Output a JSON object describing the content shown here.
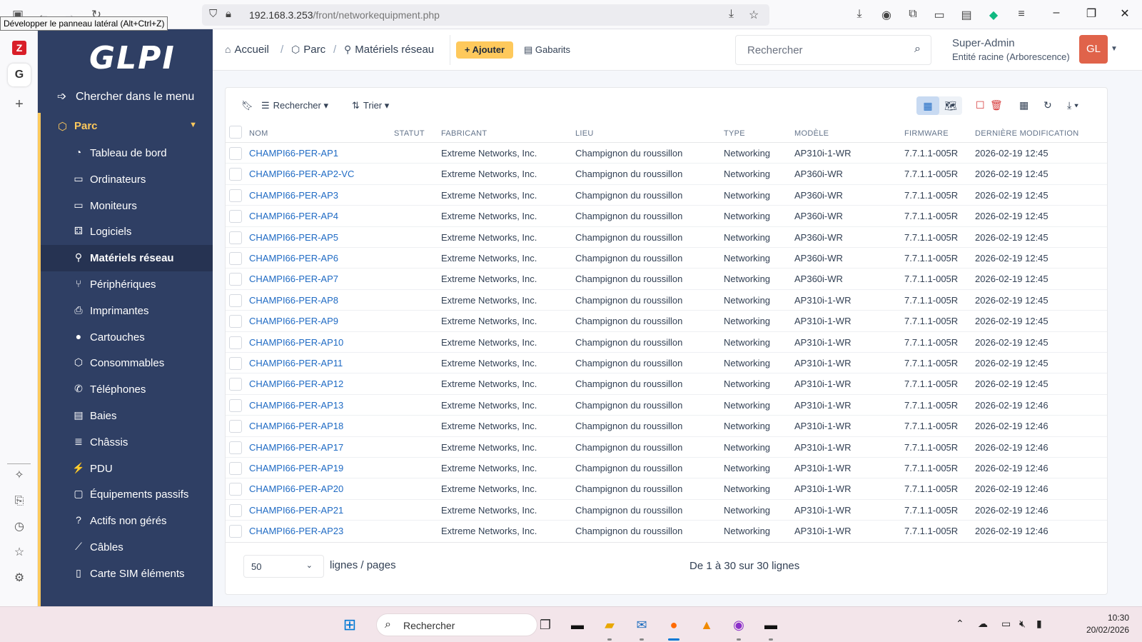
{
  "browser": {
    "tooltip": "Développer le panneau latéral (Alt+Ctrl+Z)",
    "url_host": "192.168.3.253",
    "url_path": "/front/networkequipment.php"
  },
  "sidebar": {
    "logo": "GLPI",
    "search_label": "Chercher dans le menu",
    "section": "Parc",
    "items": [
      {
        "label": "Tableau de bord",
        "icon": "dashboard-icon"
      },
      {
        "label": "Ordinateurs",
        "icon": "laptop-icon"
      },
      {
        "label": "Moniteurs",
        "icon": "monitor-icon"
      },
      {
        "label": "Logiciels",
        "icon": "apps-icon"
      },
      {
        "label": "Matériels réseau",
        "icon": "network-icon"
      },
      {
        "label": "Périphériques",
        "icon": "usb-icon"
      },
      {
        "label": "Imprimantes",
        "icon": "printer-icon"
      },
      {
        "label": "Cartouches",
        "icon": "droplet-icon"
      },
      {
        "label": "Consommables",
        "icon": "package-icon"
      },
      {
        "label": "Téléphones",
        "icon": "phone-icon"
      },
      {
        "label": "Baies",
        "icon": "server-icon"
      },
      {
        "label": "Châssis",
        "icon": "list-icon"
      },
      {
        "label": "PDU",
        "icon": "plug-icon"
      },
      {
        "label": "Équipements passifs",
        "icon": "box-icon"
      },
      {
        "label": "Actifs non gérés",
        "icon": "question-icon"
      },
      {
        "label": "Câbles",
        "icon": "cable-icon"
      },
      {
        "label": "Carte SIM éléments",
        "icon": "sim-icon"
      }
    ],
    "active_index": 4
  },
  "header": {
    "breadcrumbs": [
      "Accueil",
      "Parc",
      "Matériels réseau"
    ],
    "add_label": "Ajouter",
    "templates_label": "Gabarits",
    "search_placeholder": "Rechercher",
    "user_name": "Super-Admin",
    "user_entity": "Entité racine (Arborescence)",
    "avatar_initials": "GL"
  },
  "toolbar": {
    "search_label": "Rechercher",
    "sort_label": "Trier"
  },
  "table": {
    "columns": [
      "NOM",
      "STATUT",
      "FABRICANT",
      "LIEU",
      "TYPE",
      "MODÈLE",
      "FIRMWARE",
      "DERNIÈRE MODIFICATION"
    ],
    "rows": [
      {
        "nom": "CHAMPI66-PER-AP1",
        "statut": "",
        "fabricant": "Extreme Networks, Inc.",
        "lieu": "Champignon du roussillon",
        "type": "Networking",
        "modele": "AP310i-1-WR",
        "firmware": "7.7.1.1-005R",
        "modif": "2026-02-19 12:45"
      },
      {
        "nom": "CHAMPI66-PER-AP2-VC",
        "statut": "",
        "fabricant": "Extreme Networks, Inc.",
        "lieu": "Champignon du roussillon",
        "type": "Networking",
        "modele": "AP360i-WR",
        "firmware": "7.7.1.1-005R",
        "modif": "2026-02-19 12:45"
      },
      {
        "nom": "CHAMPI66-PER-AP3",
        "statut": "",
        "fabricant": "Extreme Networks, Inc.",
        "lieu": "Champignon du roussillon",
        "type": "Networking",
        "modele": "AP360i-WR",
        "firmware": "7.7.1.1-005R",
        "modif": "2026-02-19 12:45"
      },
      {
        "nom": "CHAMPI66-PER-AP4",
        "statut": "",
        "fabricant": "Extreme Networks, Inc.",
        "lieu": "Champignon du roussillon",
        "type": "Networking",
        "modele": "AP360i-WR",
        "firmware": "7.7.1.1-005R",
        "modif": "2026-02-19 12:45"
      },
      {
        "nom": "CHAMPI66-PER-AP5",
        "statut": "",
        "fabricant": "Extreme Networks, Inc.",
        "lieu": "Champignon du roussillon",
        "type": "Networking",
        "modele": "AP360i-WR",
        "firmware": "7.7.1.1-005R",
        "modif": "2026-02-19 12:45"
      },
      {
        "nom": "CHAMPI66-PER-AP6",
        "statut": "",
        "fabricant": "Extreme Networks, Inc.",
        "lieu": "Champignon du roussillon",
        "type": "Networking",
        "modele": "AP360i-WR",
        "firmware": "7.7.1.1-005R",
        "modif": "2026-02-19 12:45"
      },
      {
        "nom": "CHAMPI66-PER-AP7",
        "statut": "",
        "fabricant": "Extreme Networks, Inc.",
        "lieu": "Champignon du roussillon",
        "type": "Networking",
        "modele": "AP360i-WR",
        "firmware": "7.7.1.1-005R",
        "modif": "2026-02-19 12:45"
      },
      {
        "nom": "CHAMPI66-PER-AP8",
        "statut": "",
        "fabricant": "Extreme Networks, Inc.",
        "lieu": "Champignon du roussillon",
        "type": "Networking",
        "modele": "AP310i-1-WR",
        "firmware": "7.7.1.1-005R",
        "modif": "2026-02-19 12:45"
      },
      {
        "nom": "CHAMPI66-PER-AP9",
        "statut": "",
        "fabricant": "Extreme Networks, Inc.",
        "lieu": "Champignon du roussillon",
        "type": "Networking",
        "modele": "AP310i-1-WR",
        "firmware": "7.7.1.1-005R",
        "modif": "2026-02-19 12:45"
      },
      {
        "nom": "CHAMPI66-PER-AP10",
        "statut": "",
        "fabricant": "Extreme Networks, Inc.",
        "lieu": "Champignon du roussillon",
        "type": "Networking",
        "modele": "AP310i-1-WR",
        "firmware": "7.7.1.1-005R",
        "modif": "2026-02-19 12:45"
      },
      {
        "nom": "CHAMPI66-PER-AP11",
        "statut": "",
        "fabricant": "Extreme Networks, Inc.",
        "lieu": "Champignon du roussillon",
        "type": "Networking",
        "modele": "AP310i-1-WR",
        "firmware": "7.7.1.1-005R",
        "modif": "2026-02-19 12:45"
      },
      {
        "nom": "CHAMPI66-PER-AP12",
        "statut": "",
        "fabricant": "Extreme Networks, Inc.",
        "lieu": "Champignon du roussillon",
        "type": "Networking",
        "modele": "AP310i-1-WR",
        "firmware": "7.7.1.1-005R",
        "modif": "2026-02-19 12:45"
      },
      {
        "nom": "CHAMPI66-PER-AP13",
        "statut": "",
        "fabricant": "Extreme Networks, Inc.",
        "lieu": "Champignon du roussillon",
        "type": "Networking",
        "modele": "AP310i-1-WR",
        "firmware": "7.7.1.1-005R",
        "modif": "2026-02-19 12:46"
      },
      {
        "nom": "CHAMPI66-PER-AP18",
        "statut": "",
        "fabricant": "Extreme Networks, Inc.",
        "lieu": "Champignon du roussillon",
        "type": "Networking",
        "modele": "AP310i-1-WR",
        "firmware": "7.7.1.1-005R",
        "modif": "2026-02-19 12:46"
      },
      {
        "nom": "CHAMPI66-PER-AP17",
        "statut": "",
        "fabricant": "Extreme Networks, Inc.",
        "lieu": "Champignon du roussillon",
        "type": "Networking",
        "modele": "AP310i-1-WR",
        "firmware": "7.7.1.1-005R",
        "modif": "2026-02-19 12:46"
      },
      {
        "nom": "CHAMPI66-PER-AP19",
        "statut": "",
        "fabricant": "Extreme Networks, Inc.",
        "lieu": "Champignon du roussillon",
        "type": "Networking",
        "modele": "AP310i-1-WR",
        "firmware": "7.7.1.1-005R",
        "modif": "2026-02-19 12:46"
      },
      {
        "nom": "CHAMPI66-PER-AP20",
        "statut": "",
        "fabricant": "Extreme Networks, Inc.",
        "lieu": "Champignon du roussillon",
        "type": "Networking",
        "modele": "AP310i-1-WR",
        "firmware": "7.7.1.1-005R",
        "modif": "2026-02-19 12:46"
      },
      {
        "nom": "CHAMPI66-PER-AP21",
        "statut": "",
        "fabricant": "Extreme Networks, Inc.",
        "lieu": "Champignon du roussillon",
        "type": "Networking",
        "modele": "AP310i-1-WR",
        "firmware": "7.7.1.1-005R",
        "modif": "2026-02-19 12:46"
      },
      {
        "nom": "CHAMPI66-PER-AP23",
        "statut": "",
        "fabricant": "Extreme Networks, Inc.",
        "lieu": "Champignon du roussillon",
        "type": "Networking",
        "modele": "AP310i-1-WR",
        "firmware": "7.7.1.1-005R",
        "modif": "2026-02-19 12:46"
      }
    ]
  },
  "pagination": {
    "per_page": "50",
    "per_page_label": "lignes / pages",
    "count_label": "De 1 à 30 sur 30 lignes"
  },
  "taskbar": {
    "search_placeholder": "Rechercher",
    "time": "10:30",
    "date": "20/02/2026"
  },
  "colors": {
    "sidebar_bg": "#2f3f64",
    "accent": "#fec95c",
    "link": "#206bc4",
    "avatar": "#e0634a"
  }
}
